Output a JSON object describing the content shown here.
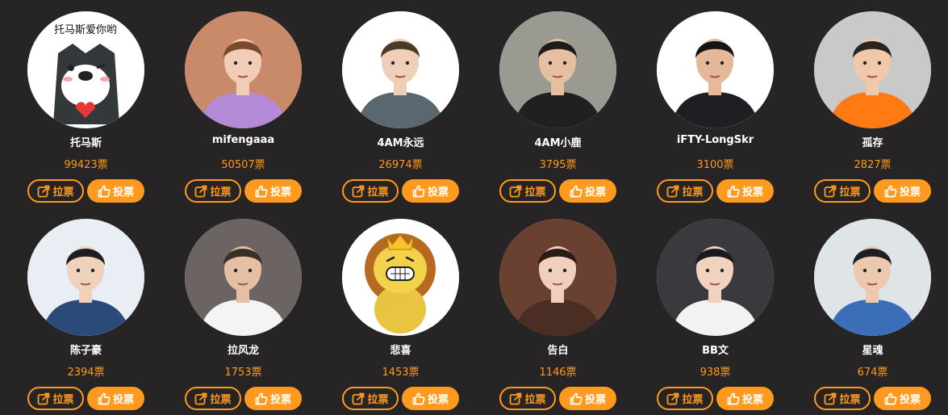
{
  "buttons": {
    "pull_label": "拉票",
    "vote_label": "投票"
  },
  "accent_color": "#ff9a1f",
  "cards": [
    {
      "name": "托马斯",
      "votes": "99423票",
      "avatar_caption": "托马斯爱你哟",
      "avatar": "cartoon-husky-dog",
      "bg": "#ffffff"
    },
    {
      "name": "mifengaaa",
      "votes": "50507票",
      "avatar": "photo-woman-long-hair",
      "bg": "#c98a6a"
    },
    {
      "name": "4AM永远",
      "votes": "26974票",
      "avatar": "photo-man-jacket",
      "bg": "#ffffff"
    },
    {
      "name": "4AM小鹿",
      "votes": "3795票",
      "avatar": "photo-man-black-jersey",
      "bg": "#9a9a92"
    },
    {
      "name": "iFTY-LongSkr",
      "votes": "3100票",
      "avatar": "photo-man-black-jersey-arms-crossed",
      "bg": "#ffffff"
    },
    {
      "name": "孤存",
      "votes": "2827票",
      "avatar": "photo-man-orange-shirt",
      "bg": "#c9c9c9"
    },
    {
      "name": "陈子豪",
      "votes": "2394票",
      "avatar": "photo-man-glasses-suit",
      "bg": "#e8eef4"
    },
    {
      "name": "拉风龙",
      "votes": "1753票",
      "avatar": "photo-man-white-suit",
      "bg": "#6b6462"
    },
    {
      "name": "悲喜",
      "votes": "1453票",
      "avatar": "cartoon-lion-crown",
      "bg": "#ffffff"
    },
    {
      "name": "告白",
      "votes": "1146票",
      "avatar": "photo-woman-portrait",
      "bg": "#6a4030"
    },
    {
      "name": "BB文",
      "votes": "938票",
      "avatar": "photo-man-white-blazer",
      "bg": "#3a3a3e"
    },
    {
      "name": "星魂",
      "votes": "674票",
      "avatar": "photo-man-blue-hoodie",
      "bg": "#dfe4e8"
    }
  ]
}
